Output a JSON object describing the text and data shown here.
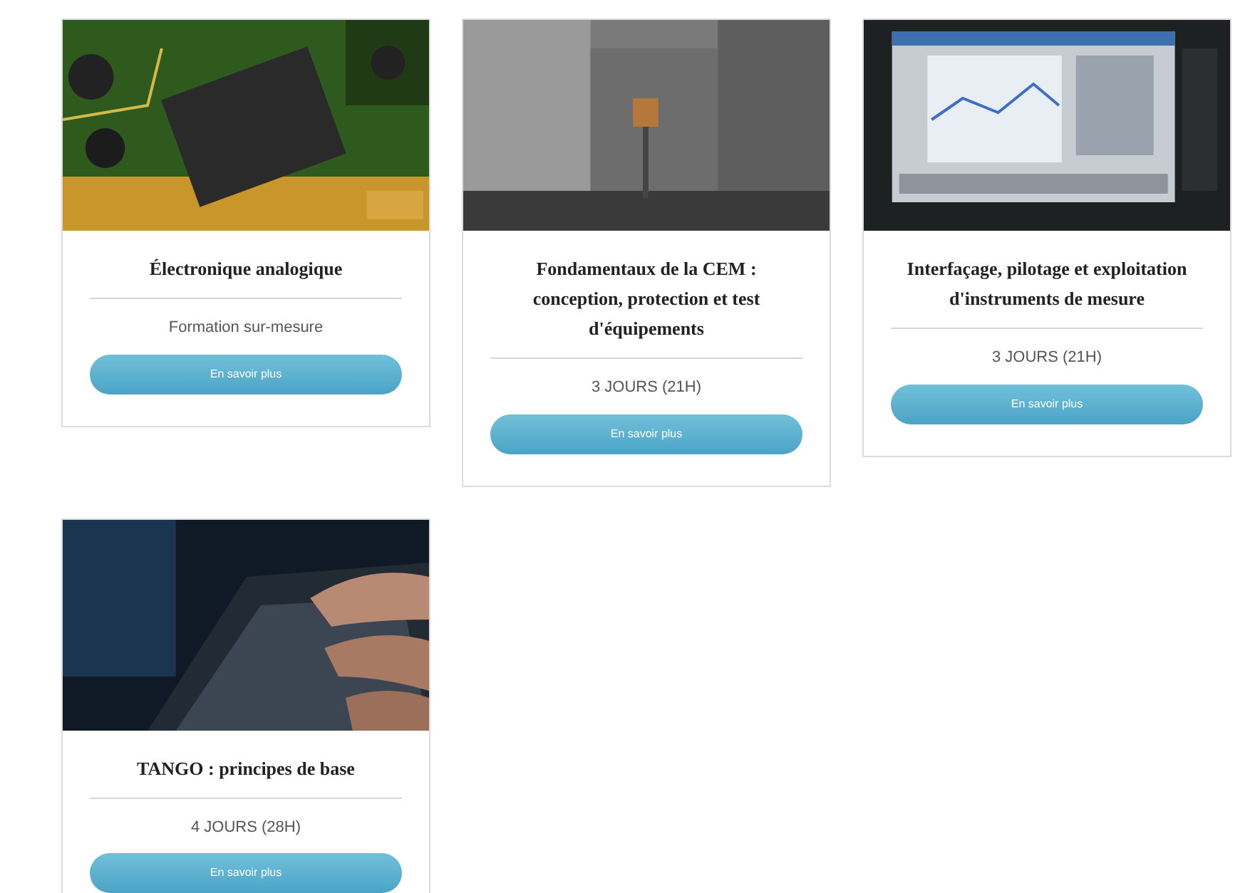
{
  "courses": [
    {
      "title": "Électronique analogique",
      "meta": "Formation sur-mesure",
      "button": "En savoir plus"
    },
    {
      "title": "Fondamentaux de la CEM : conception, protection et test d'équipements",
      "meta": "3 JOURS (21H)",
      "button": "En savoir plus"
    },
    {
      "title": "Interfaçage, pilotage et exploitation d'instruments de mesure",
      "meta": "3 JOURS (21H)",
      "button": "En savoir plus"
    },
    {
      "title": "TANGO : principes de base",
      "meta": "4 JOURS (28H)",
      "button": "En savoir plus"
    }
  ]
}
